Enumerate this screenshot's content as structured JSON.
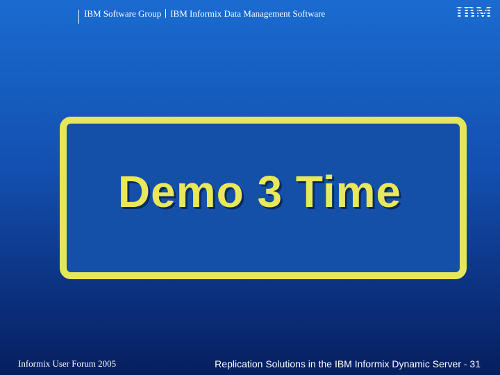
{
  "header": {
    "group": "IBM Software Group",
    "division": "IBM Informix Data Management Software",
    "logo_text": "IBM"
  },
  "main": {
    "title": "Demo 3 Time"
  },
  "footer": {
    "left": "Informix User Forum 2005",
    "right": "Replication Solutions in the IBM Informix Dynamic Server  - 31"
  },
  "colors": {
    "background_top": "#1a6bd0",
    "background_bottom": "#061f5e",
    "accent_yellow": "#e6e65a",
    "text_white": "#ffffff"
  }
}
